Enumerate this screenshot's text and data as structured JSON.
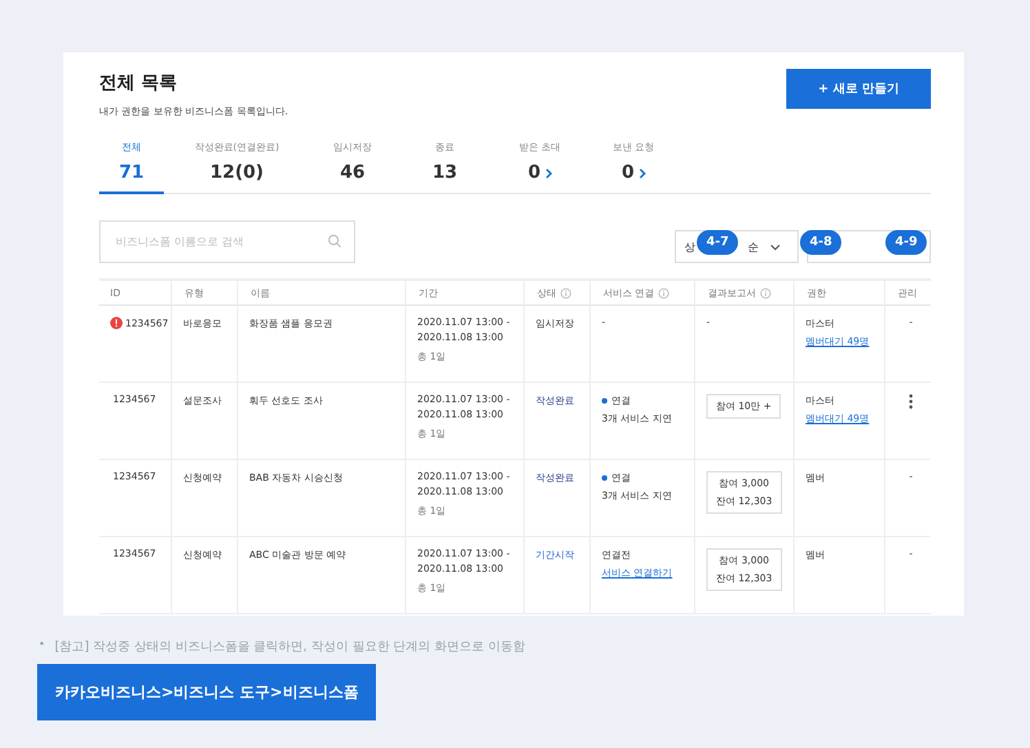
{
  "header": {
    "title": "전체 목록",
    "subtitle": "내가 권한을 보유한 비즈니스폼 목록입니다.",
    "create_button": "+ 새로 만들기"
  },
  "tabs": [
    {
      "label": "전체",
      "count": "71",
      "selected": true,
      "arrow": false
    },
    {
      "label": "작성완료(연결완료)",
      "count": "12(0)",
      "selected": false,
      "arrow": false
    },
    {
      "label": "임시저장",
      "count": "46",
      "selected": false,
      "arrow": false
    },
    {
      "label": "종료",
      "count": "13",
      "selected": false,
      "arrow": false
    },
    {
      "label": "받은 초대",
      "count": "0",
      "selected": false,
      "arrow": true
    },
    {
      "label": "보낸 요청",
      "count": "0",
      "selected": false,
      "arrow": true
    }
  ],
  "search": {
    "placeholder": "비즈니스폼 이름으로 검색"
  },
  "sort_dropdown": {
    "visible_start": "상",
    "visible_end": "순"
  },
  "badges": [
    "4-7",
    "4-8",
    "4-9"
  ],
  "table": {
    "columns": [
      {
        "label": "ID",
        "info": false
      },
      {
        "label": "유형",
        "info": false
      },
      {
        "label": "이름",
        "info": false
      },
      {
        "label": "기간",
        "info": false
      },
      {
        "label": "상태",
        "info": true
      },
      {
        "label": "서비스 연결",
        "info": true
      },
      {
        "label": "결과보고서",
        "info": true
      },
      {
        "label": "권한",
        "info": false
      },
      {
        "label": "관리",
        "info": false
      }
    ],
    "rows": [
      {
        "alert": true,
        "id": "1234567",
        "type": "바로응모",
        "name": "화장품 샘플 응모권",
        "period": [
          "2020.11.07 13:00 -",
          "2020.11.08 13:00"
        ],
        "duration": "총 1일",
        "status": {
          "text": "임시저장",
          "kind": "draft"
        },
        "service": {
          "kind": "none",
          "text": "-"
        },
        "result": {
          "kind": "none",
          "lines": [
            "-"
          ]
        },
        "role": "마스터",
        "role_link": "멤버대기 49명",
        "manage": {
          "kind": "text",
          "text": "-"
        }
      },
      {
        "alert": false,
        "id": "1234567",
        "type": "설문조사",
        "name": "훠두 선호도 조사",
        "period": [
          "2020.11.07 13:00 -",
          "2020.11.08 13:00"
        ],
        "duration": "총 1일",
        "status": {
          "text": "작성완료",
          "kind": "done"
        },
        "service": {
          "kind": "connected",
          "text": "연결",
          "sub": "3개 서비스 지연"
        },
        "result": {
          "kind": "box",
          "lines": [
            "참여 10만 +"
          ]
        },
        "role": "마스터",
        "role_link": "멤버대기 49명",
        "manage": {
          "kind": "menu"
        }
      },
      {
        "alert": false,
        "id": "1234567",
        "type": "신청예약",
        "name": "BAB 자동차 시승신청",
        "period": [
          "2020.11.07 13:00 -",
          "2020.11.08 13:00"
        ],
        "duration": "총 1일",
        "status": {
          "text": "작성완료",
          "kind": "done"
        },
        "service": {
          "kind": "connected",
          "text": "연결",
          "sub": "3개 서비스 지연"
        },
        "result": {
          "kind": "box",
          "lines": [
            "참여 3,000",
            "잔여 12,303"
          ]
        },
        "role": "멤버",
        "manage": {
          "kind": "text",
          "text": "-"
        }
      },
      {
        "alert": false,
        "id": "1234567",
        "type": "신청예약",
        "name": "ABC 미술관 방문 예약",
        "period": [
          "2020.11.07 13:00 -",
          "2020.11.08 13:00"
        ],
        "duration": "총 1일",
        "status": {
          "text": "기간시작",
          "kind": "started"
        },
        "service": {
          "kind": "unconnected",
          "text": "연결전",
          "link": "서비스 연결하기"
        },
        "result": {
          "kind": "box",
          "lines": [
            "참여 3,000",
            "잔여 12,303"
          ]
        },
        "role": "멤버",
        "manage": {
          "kind": "text",
          "text": "-"
        }
      }
    ]
  },
  "note_bullet": "•",
  "note": "[참고] 작성중 상태의 비즈니스폼을 클릭하면, 작성이 필요한 단계의 화면으로 이동함",
  "breadcrumb_button": "카카오비즈니스>비즈니스 도구>비즈니스폼"
}
